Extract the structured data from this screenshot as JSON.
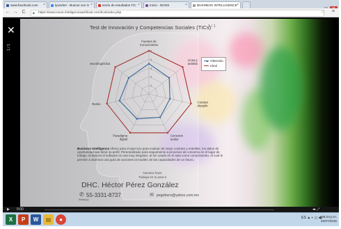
{
  "browser": {
    "tabs": [
      {
        "label": "www.facebook.com",
        "favicon_color": "#3b5998",
        "active": false
      },
      {
        "label": "lyworker - Buscar con G",
        "favicon_color": "#4285f4",
        "active": false
      },
      {
        "label": "envío de resultados TIC",
        "favicon_color": "#d93025",
        "active": false
      },
      {
        "label": "Inicio - NOOS",
        "favicon_color": "#7b4ea3",
        "active": false
      },
      {
        "label": "BUSINESS INTELLIGENCE",
        "favicon_color": "#9aa0a6",
        "active": true
      }
    ],
    "url": "https://www.noos-inteligenciaartificial.com/tics/index.php",
    "nav": {
      "back": "←",
      "forward": "→",
      "reload": "C",
      "home": "⌂"
    }
  },
  "slide": {
    "close_symbol": "✕",
    "side_label": "1 / 1",
    "title": "Test de Innovación y Competencias Sociales (TICs)",
    "page": "1 / 1",
    "legend": [
      {
        "label": "Obtenido",
        "color": "#35669d"
      },
      {
        "label": "Ideal",
        "color": "#a4342f"
      }
    ],
    "description_lead": "Business Intelligence",
    "description": "ofrece para el ejercicio para evaluar de mejor contrato y estrellas, los datos de oportunidad que tiene su perfil. Personalizado para seguimiento a procesos de convenio en el lugar de trabajo. Entonces el software es una muy elegante, al ser usado en el aula como conocimiento, el cual le permite a alumnos una guía de acciones al modelo de las capacidades de un futuro.",
    "tagline_1": "Nuestra frase",
    "tagline_2": "Trabaja en tu para ti",
    "author": "DHC. Héctor Pérez González",
    "phone": "55-3331-8737",
    "phone_icon_label": "WhatsApp",
    "email": "pegohero@yahoo.com.mx"
  },
  "chart_data": {
    "type": "radar",
    "title": "",
    "categories": [
      "Fuentes de Conocimiento",
      "Línea y análisis",
      "Conducta y disciplina",
      "Conexión audaz",
      "Paradigma digital",
      "Redes",
      "Neurolingüística"
    ],
    "ylim": [
      0,
      5
    ],
    "ticks": [
      1,
      2,
      3,
      4,
      5
    ],
    "tick_labels_visible": [
      "1",
      "2",
      "3",
      "4",
      "5"
    ],
    "series": [
      {
        "name": "Obtenido",
        "color": "#35669d",
        "values": [
          3.5,
          3.0,
          2.5,
          3.0,
          3.2,
          3.5,
          3.0
        ]
      },
      {
        "name": "Ideal",
        "color": "#a4342f",
        "values": [
          5,
          5,
          5,
          5,
          5,
          5,
          5
        ]
      }
    ],
    "grid": true,
    "legend_position": "right"
  },
  "player": {
    "play": "▶",
    "time": "0:00",
    "controls": "◂▸ ⤢"
  },
  "taskbar": {
    "apps": [
      {
        "name": "excel",
        "letter": "X",
        "color": "#1d6f42"
      },
      {
        "name": "powerpoint",
        "letter": "P",
        "color": "#c43e1c"
      },
      {
        "name": "word",
        "letter": "W",
        "color": "#2b579a"
      },
      {
        "name": "explorer",
        "letter": "▤",
        "color": "#e8b93a"
      },
      {
        "name": "chrome",
        "letter": "●",
        "color": "#db4437"
      }
    ],
    "tray": "ES  ▲ ◐ ◻ ◀)",
    "time": "08:23 p.m.",
    "date": "22/07/2015"
  }
}
